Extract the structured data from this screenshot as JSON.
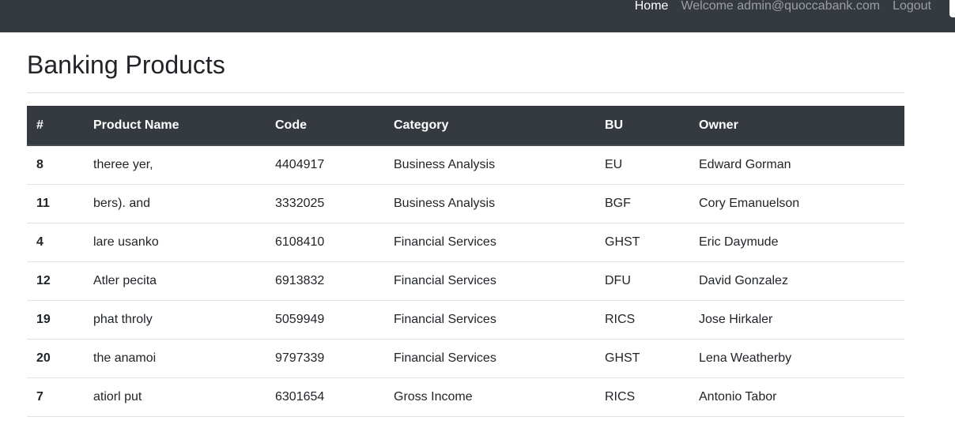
{
  "navbar": {
    "home_label": "Home",
    "welcome_text": "Welcome admin@quoccabank.com",
    "logout_label": "Logout"
  },
  "page": {
    "title": "Banking Products"
  },
  "table": {
    "headers": [
      "#",
      "Product Name",
      "Code",
      "Category",
      "BU",
      "Owner"
    ],
    "rows": [
      [
        "8",
        "theree yer,",
        "4404917",
        "Business Analysis",
        "EU",
        "Edward Gorman"
      ],
      [
        "11",
        "bers). and",
        "3332025",
        "Business Analysis",
        "BGF",
        "Cory Emanuelson"
      ],
      [
        "4",
        "lare usanko",
        "6108410",
        "Financial Services",
        "GHST",
        "Eric Daymude"
      ],
      [
        "12",
        "Atler pecita",
        "6913832",
        "Financial Services",
        "DFU",
        "David Gonzalez"
      ],
      [
        "19",
        "phat throly",
        "5059949",
        "Financial Services",
        "RICS",
        "Jose Hirkaler"
      ],
      [
        "20",
        "the anamoi",
        "9797339",
        "Financial Services",
        "GHST",
        "Lena Weatherby"
      ],
      [
        "7",
        "atiorl put",
        "6301654",
        "Gross Income",
        "RICS",
        "Antonio Tabor"
      ]
    ]
  },
  "colors": {
    "navbar_bg": "#343a40",
    "table_header_bg": "#343a40",
    "row_border": "#dee2e6"
  }
}
